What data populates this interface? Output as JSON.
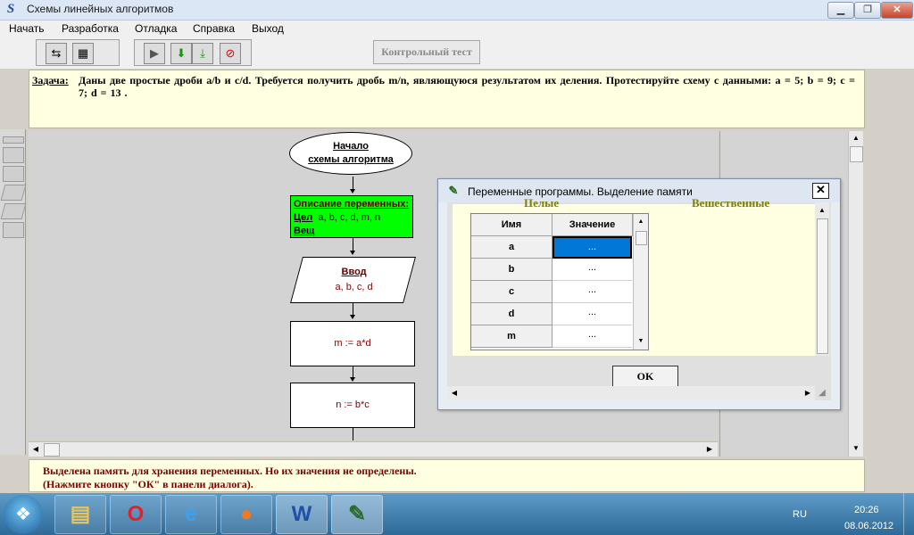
{
  "window": {
    "title": "Схемы линейных алгоритмов",
    "icon": "app-s-icon",
    "controls": [
      "minimize-icon",
      "restore-icon",
      "close-icon"
    ]
  },
  "menu": [
    "Начать",
    "Разработка",
    "Отладка",
    "Справка",
    "Выход"
  ],
  "toolbar": {
    "tools": [
      "align-icon",
      "settings-icon",
      "play-icon",
      "step-down-icon",
      "step-into-icon",
      "stop-icon"
    ],
    "test_button": "Контрольный тест"
  },
  "task": {
    "label": "Задача:",
    "text": "Даны две простые дроби a/b и c/d. Требуется получить дробь m/n, являющуюся результатом их деления.     Протестируйте схему с данными: a = 5;  b = 9;  c = 7;  d = 13 ."
  },
  "flowchart": {
    "start": [
      "Начало",
      "схемы алгоритма"
    ],
    "declare": {
      "title": "Описание переменных:",
      "int_label": "Цел",
      "int_vars": "a, b, c, d, m, n",
      "real_label": "Вещ"
    },
    "input": {
      "title": "Ввод",
      "vars": "a, b, c, d"
    },
    "assign1": "m := a*d",
    "assign2": "n := b*c"
  },
  "dialog": {
    "title": "Переменные программы. Выделение памяти",
    "close": "✕",
    "header_left": "Целые",
    "header_right": "Вещественные",
    "columns": [
      "Имя",
      "Значение"
    ],
    "rows": [
      {
        "name": "a",
        "value": "..."
      },
      {
        "name": "b",
        "value": "..."
      },
      {
        "name": "c",
        "value": "..."
      },
      {
        "name": "d",
        "value": "..."
      },
      {
        "name": "m",
        "value": "..."
      }
    ],
    "ok": "OK"
  },
  "status": {
    "line1": "Выделена память для хранения переменных.    Но их значения не определены.",
    "line2": "(Нажмите кнопку \"ОК\" в панели диалога)."
  },
  "taskbar": {
    "apps": [
      "explorer-icon",
      "opera-icon",
      "ie-icon",
      "firefox-icon",
      "word-icon",
      "algo-app-icon"
    ],
    "lang": "RU",
    "time": "20:26",
    "date": "08.06.2012"
  },
  "colors": {
    "panel_bg": "#ffffe1",
    "declare_bg": "#00ff00",
    "status_text": "#7a0000",
    "selected_cell": "#0078d7"
  }
}
